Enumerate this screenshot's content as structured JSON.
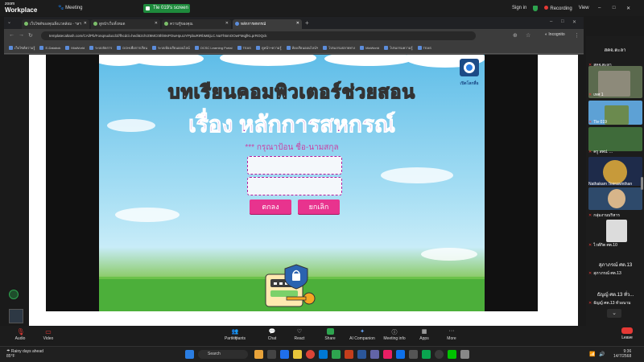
{
  "zoom": {
    "brand_small": "zoom",
    "brand": "Workplace",
    "meeting_label": "Meeting",
    "share_label": "Tle 019's screen",
    "signin": "Sign in",
    "recording": "Recording",
    "view": "View"
  },
  "browser": {
    "tabs": [
      {
        "label": "เว็บไซต์ของคุณสิ่งแวดล้อม - ฯลฯ"
      },
      {
        "label": "ดูหน้าเว็บทั้งหมด"
      },
      {
        "label": "ความรู้ของคุณ"
      },
      {
        "label": "หลักการสหกรณ์",
        "active": true
      }
    ],
    "url": "templatecaltash.com/CAl/Pb/Fonqnuducd1f/fhcdcl=hedi62clVZ9MC0thh9sPOwHpuUYPpbuRIRbMEjLC.NaTh5mOOwFMqjfKLprROQck",
    "incognito": "Incognito",
    "bookmarks": [
      "เว็บไซต์ความรู้",
      "E-Databok",
      "MiaWorld",
      "ระบบจัดการ",
      "DOHเพื่อการเรียน",
      "ระบบห้องเรียนออนไลน์",
      "OCSC Learning Portal",
      "TEAS",
      "ดูหน้า+ความรู้",
      "ห้องเรียนออนไลน์ฯ",
      "โปรแกรมปลายทาง",
      "MiaWorld",
      "โปรแกรมความรู้",
      "TEAS"
    ]
  },
  "game": {
    "title1": "บทเรียนคอมพิวเตอร์ช่วยสอน",
    "title2": "เรื่อง หลักการสหกรณ์",
    "prompt": "*** กรุณาป้อน ชื่อ-นามสกุล",
    "ok_button": "ตกลง",
    "cancel_button": "ยกเลิก",
    "logo_label": "เปิดโลกสื่อ",
    "input1_value": "",
    "input2_value": ""
  },
  "participants": {
    "header": "สคจ.ตะลา",
    "items": [
      {
        "name": "สคจ.ตะลา"
      },
      {
        "name": "เทศ 1"
      },
      {
        "name": "Tle 019"
      },
      {
        "name": "ครู สพป. ..."
      },
      {
        "name": "Nathakarn Teerawinthan"
      },
      {
        "name": "กลุ่มงานบริหาร"
      },
      {
        "name": "ไวพ์กิต ศต.10"
      },
      {
        "name": "สุภาภรณ์ ศต.13"
      },
      {
        "name": "สุภาภรณ์ ศต.13"
      },
      {
        "name": "ธัญญ์ ศต.13 ทั่ว..."
      },
      {
        "name": "ธัญญ์ ศต.13 ทั่วอนาม"
      }
    ]
  },
  "toolbar": {
    "audio": "Audio",
    "video": "Video",
    "participants": "Participants",
    "participants_count": "107",
    "chat": "Chat",
    "react": "React",
    "share": "Share",
    "companion": "AI Companion",
    "meeting_info": "Meeting info",
    "apps": "Apps",
    "more": "More",
    "leave": "Leave"
  },
  "taskbar": {
    "weather_title": "Rainy days ahead",
    "weather_temp": "85°F",
    "search": "Search",
    "time": "9:36",
    "date": "14/7/2568"
  }
}
